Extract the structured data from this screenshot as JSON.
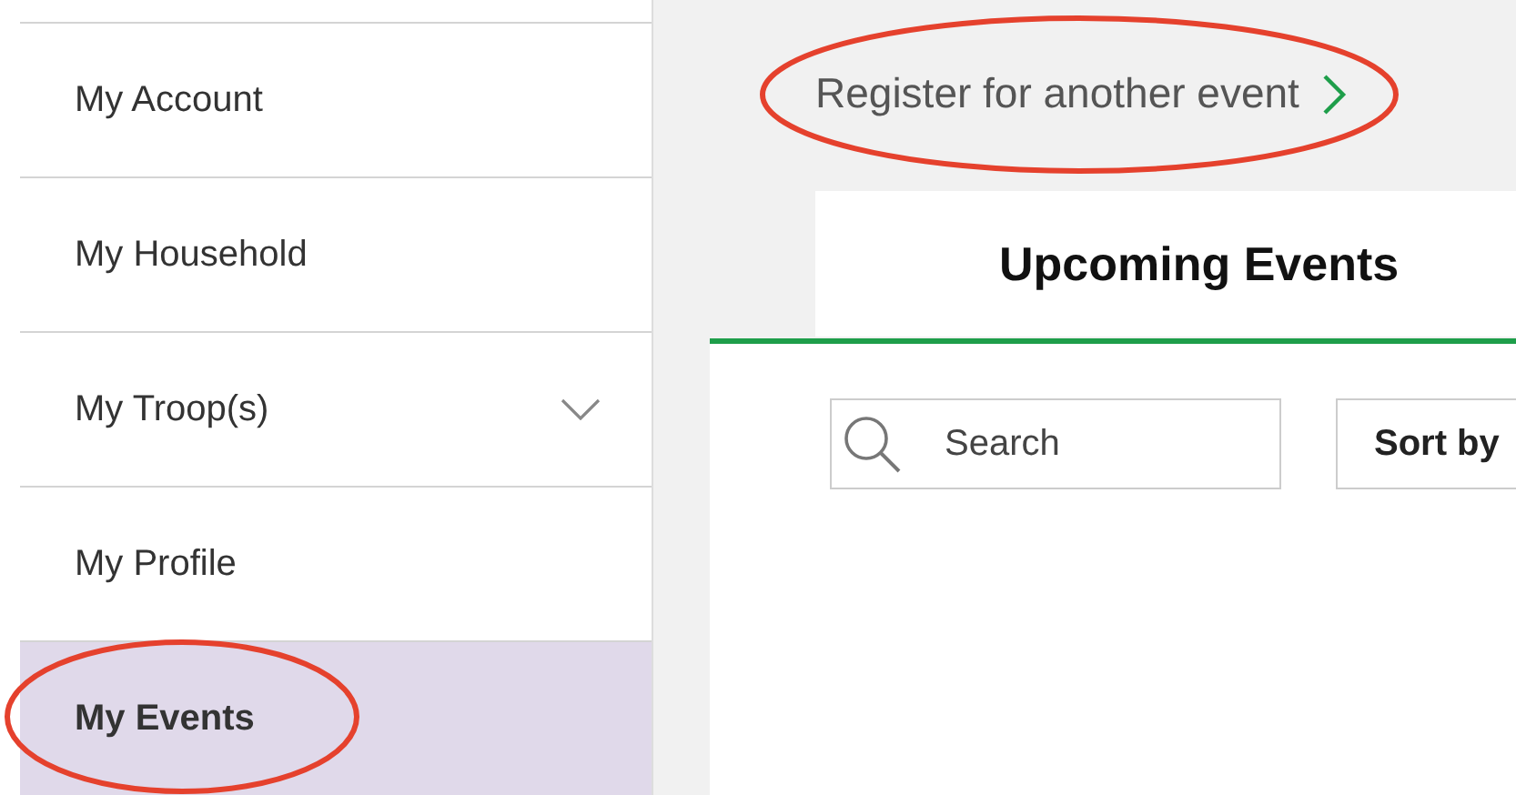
{
  "sidebar": {
    "items": [
      {
        "label": "My Account",
        "selected": false,
        "expandable": false
      },
      {
        "label": "My Household",
        "selected": false,
        "expandable": false
      },
      {
        "label": "My Troop(s)",
        "selected": false,
        "expandable": true
      },
      {
        "label": "My Profile",
        "selected": false,
        "expandable": false
      },
      {
        "label": "My Events",
        "selected": true,
        "expandable": false
      }
    ]
  },
  "register_link": {
    "label": "Register for another event"
  },
  "tabs": [
    {
      "label": "Upcoming Events",
      "selected": true
    }
  ],
  "search": {
    "placeholder": "Search"
  },
  "sort_button": {
    "label": "Sort by"
  }
}
